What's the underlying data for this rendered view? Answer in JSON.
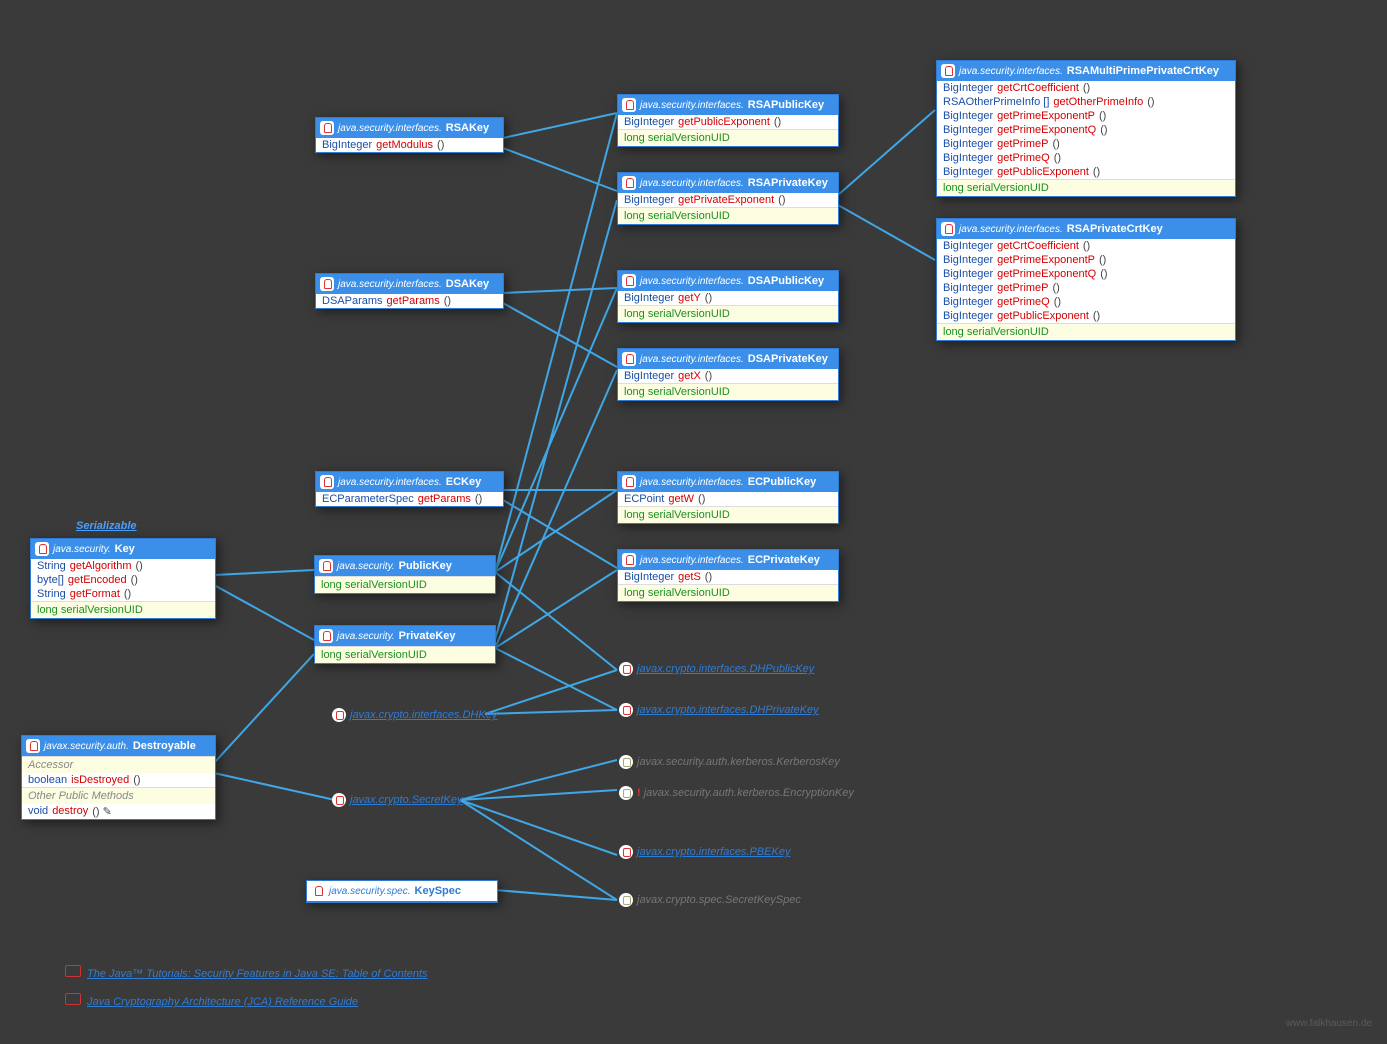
{
  "serializable": "Serializable",
  "boxes": {
    "key": {
      "pkg": "java.security.",
      "name": "Key",
      "rows": [
        [
          "String",
          "getAlgorithm",
          "()"
        ],
        [
          "byte[]",
          "getEncoded",
          "()"
        ],
        [
          "String",
          "getFormat",
          "()"
        ]
      ],
      "field": "long serialVersionUID"
    },
    "destroyable": {
      "pkg": "javax.security.auth.",
      "name": "Destroyable",
      "sect1": "Accessor",
      "rows1": [
        [
          "boolean",
          "isDestroyed",
          "()"
        ]
      ],
      "sect2": "Other Public Methods",
      "rows2": [
        [
          "void",
          "destroy",
          "() ✎"
        ]
      ]
    },
    "rsakey": {
      "pkg": "java.security.interfaces.",
      "name": "RSAKey",
      "rows": [
        [
          "BigInteger",
          "getModulus",
          "()"
        ]
      ]
    },
    "dsakey": {
      "pkg": "java.security.interfaces.",
      "name": "DSAKey",
      "rows": [
        [
          "DSAParams",
          "getParams",
          "()"
        ]
      ]
    },
    "eckey": {
      "pkg": "java.security.interfaces.",
      "name": "ECKey",
      "rows": [
        [
          "ECParameterSpec",
          "getParams",
          "()"
        ]
      ]
    },
    "publickey": {
      "pkg": "java.security.",
      "name": "PublicKey",
      "field": "long serialVersionUID"
    },
    "privatekey": {
      "pkg": "java.security.",
      "name": "PrivateKey",
      "field": "long serialVersionUID"
    },
    "keyspec": {
      "pkg": "java.security.spec.",
      "name": "KeySpec"
    },
    "rsapub": {
      "pkg": "java.security.interfaces.",
      "name": "RSAPublicKey",
      "rows": [
        [
          "BigInteger",
          "getPublicExponent",
          "()"
        ]
      ],
      "field": "long serialVersionUID"
    },
    "rsapriv": {
      "pkg": "java.security.interfaces.",
      "name": "RSAPrivateKey",
      "rows": [
        [
          "BigInteger",
          "getPrivateExponent",
          "()"
        ]
      ],
      "field": "long serialVersionUID"
    },
    "dsapub": {
      "pkg": "java.security.interfaces.",
      "name": "DSAPublicKey",
      "rows": [
        [
          "BigInteger",
          "getY",
          "()"
        ]
      ],
      "field": "long serialVersionUID"
    },
    "dsapriv": {
      "pkg": "java.security.interfaces.",
      "name": "DSAPrivateKey",
      "rows": [
        [
          "BigInteger",
          "getX",
          "()"
        ]
      ],
      "field": "long serialVersionUID"
    },
    "ecpub": {
      "pkg": "java.security.interfaces.",
      "name": "ECPublicKey",
      "rows": [
        [
          "ECPoint",
          "getW",
          "()"
        ]
      ],
      "field": "long serialVersionUID"
    },
    "ecpriv": {
      "pkg": "java.security.interfaces.",
      "name": "ECPrivateKey",
      "rows": [
        [
          "BigInteger",
          "getS",
          "()"
        ]
      ],
      "field": "long serialVersionUID"
    },
    "rsampp": {
      "pkg": "java.security.interfaces.",
      "name": "RSAMultiPrimePrivateCrtKey",
      "rows": [
        [
          "BigInteger",
          "getCrtCoefficient",
          "()"
        ],
        [
          "RSAOtherPrimeInfo []",
          "getOtherPrimeInfo",
          "()"
        ],
        [
          "BigInteger",
          "getPrimeExponentP",
          "()"
        ],
        [
          "BigInteger",
          "getPrimeExponentQ",
          "()"
        ],
        [
          "BigInteger",
          "getPrimeP",
          "()"
        ],
        [
          "BigInteger",
          "getPrimeQ",
          "()"
        ],
        [
          "BigInteger",
          "getPublicExponent",
          "()"
        ]
      ],
      "field": "long serialVersionUID"
    },
    "rsacrt": {
      "pkg": "java.security.interfaces.",
      "name": "RSAPrivateCrtKey",
      "rows": [
        [
          "BigInteger",
          "getCrtCoefficient",
          "()"
        ],
        [
          "BigInteger",
          "getPrimeExponentP",
          "()"
        ],
        [
          "BigInteger",
          "getPrimeExponentQ",
          "()"
        ],
        [
          "BigInteger",
          "getPrimeP",
          "()"
        ],
        [
          "BigInteger",
          "getPrimeQ",
          "()"
        ],
        [
          "BigInteger",
          "getPublicExponent",
          "()"
        ]
      ],
      "field": "long serialVersionUID"
    }
  },
  "labels": {
    "dhkey": "javax.crypto.interfaces.DHKey",
    "secretkey": "javax.crypto.SecretKey",
    "dhpub": "javax.crypto.interfaces.DHPublicKey",
    "dhpriv": "javax.crypto.interfaces.DHPrivateKey",
    "kerb": "javax.security.auth.kerberos.KerberosKey",
    "enckey": "javax.security.auth.kerberos.EncryptionKey",
    "pbekey": "javax.crypto.interfaces.PBEKey",
    "skspec": "javax.crypto.spec.SecretKeySpec",
    "excl": "!"
  },
  "footer": {
    "t1": "The Java™ Tutorials: Security Features in Java SE: Table of Contents",
    "t2": "Java Cryptography Architecture (JCA) Reference Guide"
  },
  "watermark": "www.falkhausen.de"
}
